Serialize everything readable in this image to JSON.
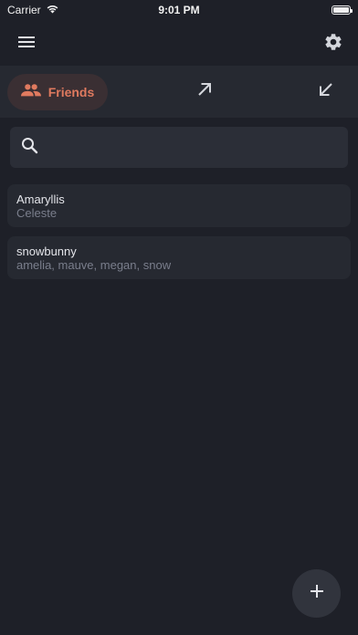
{
  "status_bar": {
    "carrier": "Carrier",
    "time": "9:01 PM",
    "battery_level": 1.0
  },
  "app_bar": {
    "menu_icon": "menu-icon",
    "settings_icon": "gear-icon"
  },
  "tabs": [
    {
      "label": "Friends",
      "icon": "people-icon",
      "selected": true
    },
    {
      "label": "",
      "icon": "arrow-up-right-icon",
      "selected": false
    },
    {
      "label": "",
      "icon": "arrow-down-left-icon",
      "selected": false
    }
  ],
  "search": {
    "placeholder": "",
    "value": "",
    "icon": "search-icon"
  },
  "friends": [
    {
      "name": "Amaryllis",
      "aliases": "Celeste"
    },
    {
      "name": "snowbunny",
      "aliases": "amelia, mauve, megan, snow"
    }
  ],
  "fab": {
    "icon": "plus-icon"
  },
  "colors": {
    "accent": "#e07a5f",
    "background": "#1e2028",
    "surface": "#262931"
  }
}
